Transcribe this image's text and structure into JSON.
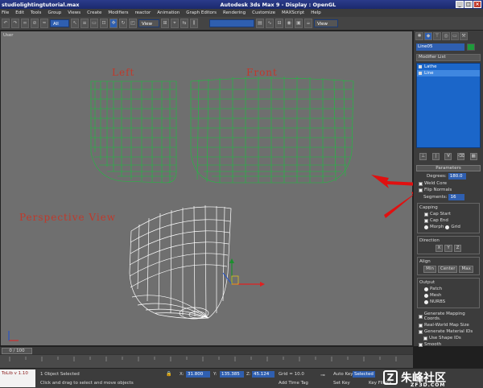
{
  "window": {
    "title": "studiolightingtutorial.max",
    "app_title": "Autodesk 3ds Max 9     - Display : OpenGL"
  },
  "menu": [
    "File",
    "Edit",
    "Tools",
    "Group",
    "Views",
    "Create",
    "Modifiers",
    "reactor",
    "Animation",
    "Graph Editors",
    "Rendering",
    "Customize",
    "MAXScript",
    "Help"
  ],
  "toolbar": {
    "filter": "All",
    "coord_system": "View",
    "coord_system2": "View"
  },
  "viewport": {
    "label": "User",
    "left_label": "Left",
    "front_label": "Front",
    "persp_label": "Perspective View"
  },
  "command_panel": {
    "object_name": "Line05",
    "modifier_list": "Modifier List",
    "stack": [
      "Lathe",
      "Line"
    ],
    "rollout_title": "Parameters",
    "degrees_label": "Degrees:",
    "degrees_value": "180.0",
    "weld_core": "Weld Core",
    "flip_normals": "Flip Normals",
    "segments_label": "Segments:",
    "segments_value": "16",
    "capping_title": "Capping",
    "cap_start": "Cap Start",
    "cap_end": "Cap End",
    "morph": "Morph",
    "grid": "Grid",
    "direction_title": "Direction",
    "dir_x": "X",
    "dir_y": "Y",
    "dir_z": "Z",
    "align_title": "Align",
    "align_min": "Min",
    "align_center": "Center",
    "align_max": "Max",
    "output_title": "Output",
    "patch": "Patch",
    "mesh": "Mesh",
    "nurbs": "NURBS",
    "gen_mapping": "Generate Mapping Coords.",
    "real_world": "Real-World Map Size",
    "gen_material": "Generate Material IDs",
    "use_shape_ids": "Use Shape IDs",
    "smooth": "Smooth"
  },
  "timeline": {
    "position": "0 / 100"
  },
  "status": {
    "maxscript": "ToLib v 1.10",
    "selection": "1 Object Selected",
    "prompt": "Click and drag to select and move objects",
    "x_label": "X:",
    "x": "31.800",
    "y_label": "Y:",
    "y": "135.385",
    "z_label": "Z:",
    "z": "45.124",
    "grid": "Grid = 10.0",
    "add_time_tag": "Add Time Tag",
    "auto_key": "Auto Key",
    "selected": "Selected",
    "set_key": "Set Key",
    "key_filters": "Key Filters...",
    "watermark": "朱峰社区",
    "watermark_url": "ZF3D.COM"
  }
}
